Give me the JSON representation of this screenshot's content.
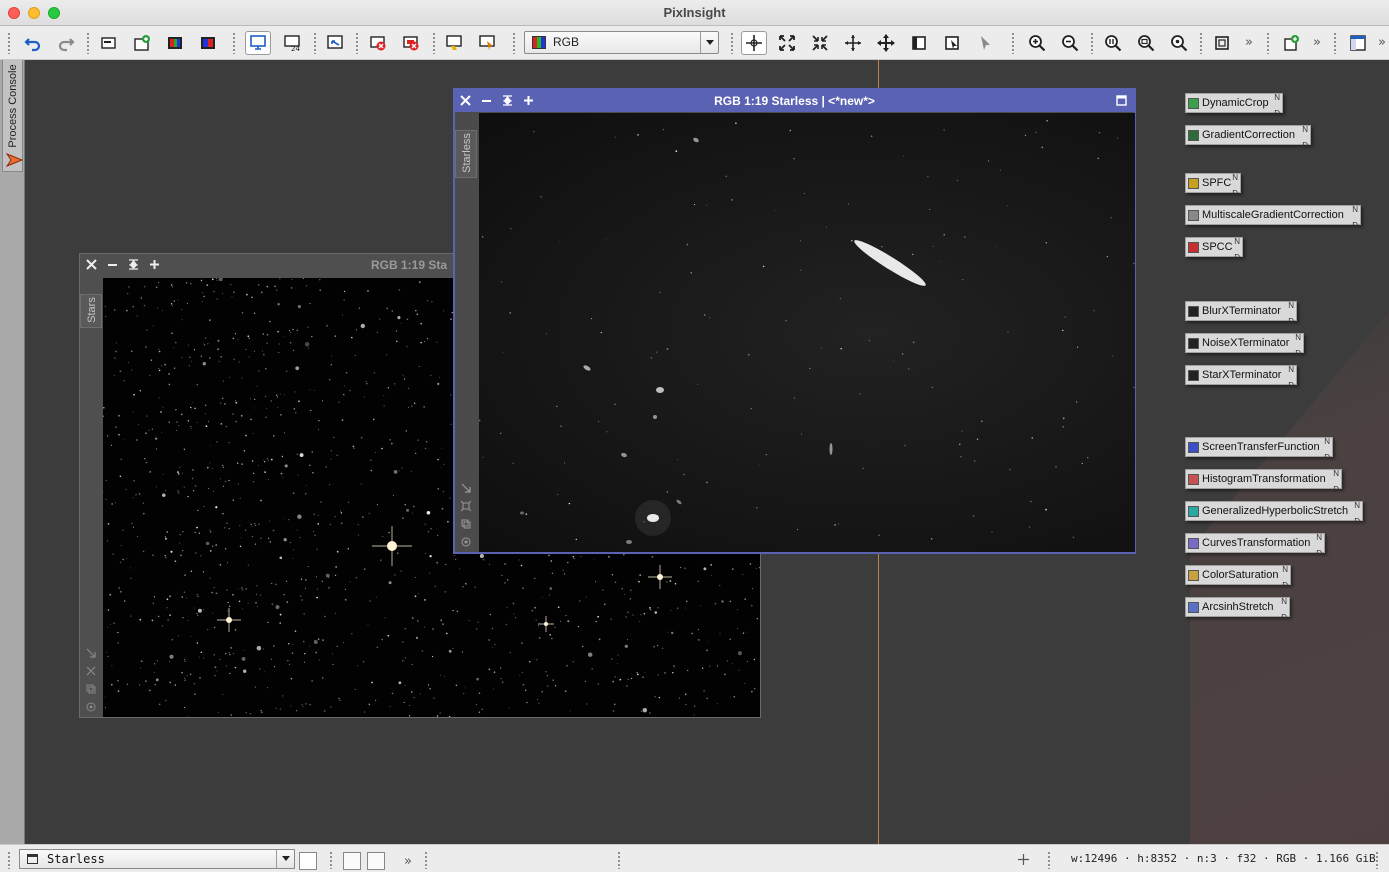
{
  "app": {
    "title": "PixInsight"
  },
  "toolbar": {
    "channel_select": {
      "value": "RGB"
    },
    "overflow": "»"
  },
  "left_panel": {
    "process_console_label": "Process Console"
  },
  "windows": {
    "stars": {
      "title": "RGB 1:19 Sta",
      "tab_label": "Stars"
    },
    "starless": {
      "title": "RGB 1:19 Starless | <*new*>",
      "tab_label": "Starless"
    }
  },
  "processes": [
    {
      "label": "DynamicCrop",
      "icon": "crop-icon",
      "color": "#3aa04a"
    },
    {
      "label": "GradientCorrection",
      "icon": "gradient-icon",
      "color": "#2d6b3a"
    },
    {
      "label": "SPFC",
      "icon": "spfc-icon",
      "color": "#c8a020"
    },
    {
      "label": "MultiscaleGradientCorrection",
      "icon": "gradient-icon",
      "color": "#888888"
    },
    {
      "label": "SPCC",
      "icon": "spcc-icon",
      "color": "#c83030"
    },
    {
      "label": "BlurXTerminator",
      "icon": "letter-b-icon",
      "color": "#222222"
    },
    {
      "label": "NoiseXTerminator",
      "icon": "letter-n-icon",
      "color": "#222222"
    },
    {
      "label": "StarXTerminator",
      "icon": "letter-s-icon",
      "color": "#222222"
    },
    {
      "label": "ScreenTransferFunction",
      "icon": "stf-icon",
      "color": "#3a4fc8"
    },
    {
      "label": "HistogramTransformation",
      "icon": "histogram-icon",
      "color": "#c85050"
    },
    {
      "label": "GeneralizedHyperbolicStretch",
      "icon": "ghs-icon",
      "color": "#28a8a0"
    },
    {
      "label": "CurvesTransformation",
      "icon": "curves-icon",
      "color": "#7a6ac8"
    },
    {
      "label": "ColorSaturation",
      "icon": "saturation-icon",
      "color": "#c8a040"
    },
    {
      "label": "ArcsinhStretch",
      "icon": "arcsinh-icon",
      "color": "#5a70c8"
    }
  ],
  "statusbar": {
    "view_select": "Starless",
    "info": "w:12496 · h:8352 · n:3 · f32 · RGB · 1.166 GiB",
    "overflow": "»"
  }
}
